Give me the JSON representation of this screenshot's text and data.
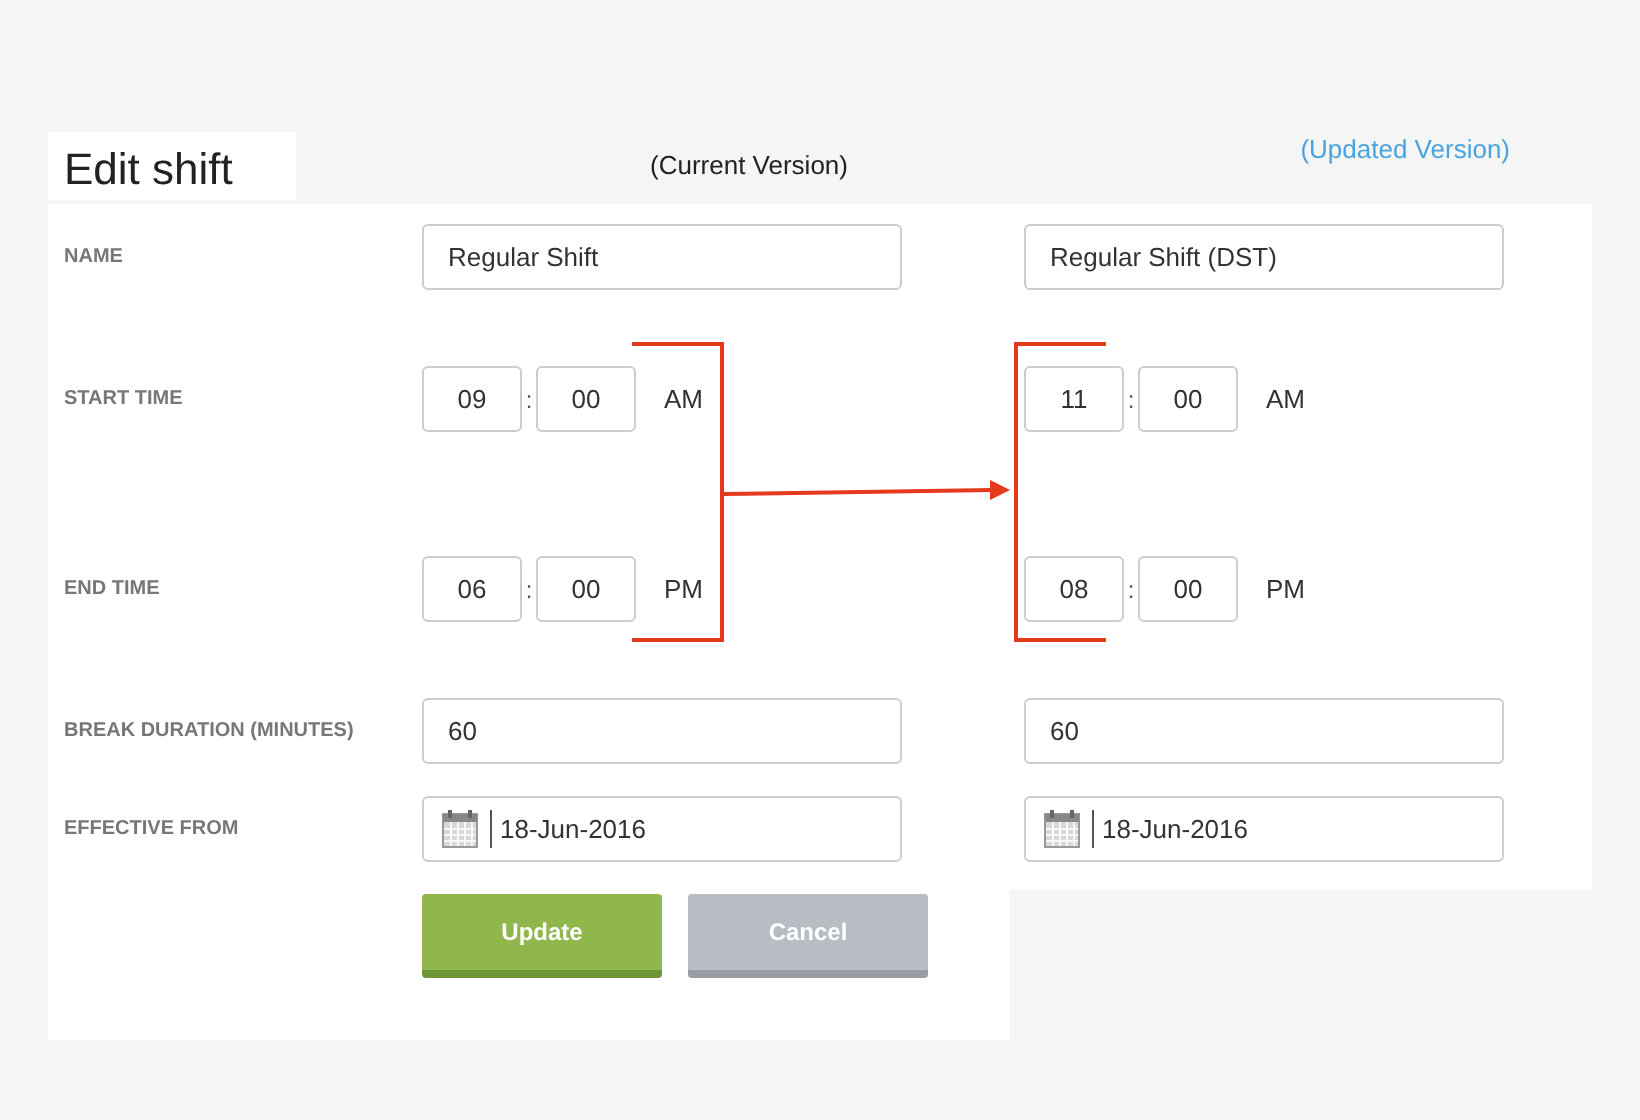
{
  "title": "Edit shift",
  "labels": [
    "NAME",
    "START TIME",
    "END TIME",
    "BREAK DURATION (MINUTES)",
    "EFFECTIVE FROM"
  ],
  "versions": [
    {
      "heading": "(Current Version)",
      "highlighted": false,
      "name": "Regular Shift",
      "start": {
        "hour": "09",
        "separator": ":",
        "minute": "00",
        "period": "AM"
      },
      "end": {
        "hour": "06",
        "separator": ":",
        "minute": "00",
        "period": "PM"
      },
      "break": "60",
      "effective_from": "18-Jun-2016"
    },
    {
      "heading": "(Updated Version)",
      "highlighted": true,
      "name": "Regular Shift (DST)",
      "start": {
        "hour": "11",
        "separator": ":",
        "minute": "00",
        "period": "AM"
      },
      "end": {
        "hour": "08",
        "separator": ":",
        "minute": "00",
        "period": "PM"
      },
      "break": "60",
      "effective_from": "18-Jun-2016"
    }
  ],
  "buttons": [
    {
      "label": "Update",
      "kind": "primary"
    },
    {
      "label": "Cancel",
      "kind": "secondary"
    }
  ]
}
